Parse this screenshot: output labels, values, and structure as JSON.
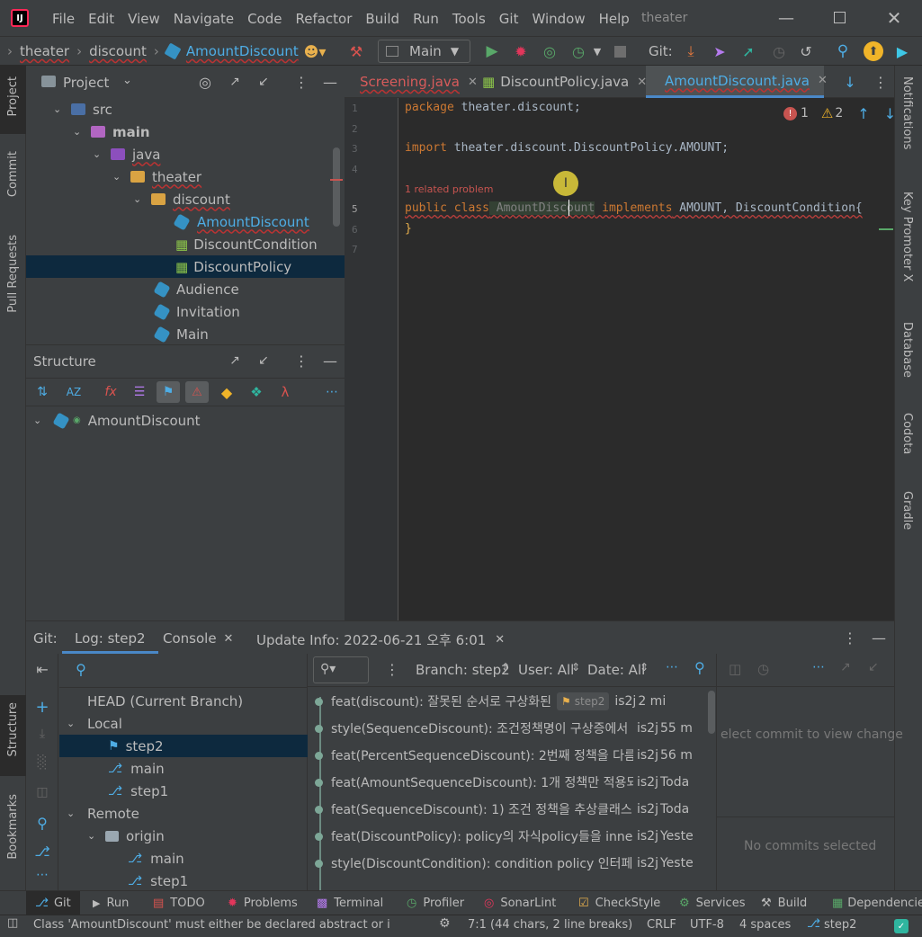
{
  "titlebar": {
    "menu": [
      "File",
      "Edit",
      "View",
      "Navigate",
      "Code",
      "Refactor",
      "Build",
      "Run",
      "Tools",
      "Git",
      "Window",
      "Help"
    ],
    "project_name": "theater"
  },
  "toolbar": {
    "breadcrumbs": [
      "theater",
      "discount",
      "AmountDiscount"
    ],
    "run_config": "Main",
    "git_label": "Git:"
  },
  "left_tools": [
    "Project",
    "Commit",
    "Pull Requests",
    "Structure",
    "Bookmarks"
  ],
  "right_tools": [
    "Notifications",
    "Key Promoter X",
    "Database",
    "Codota",
    "Gradle"
  ],
  "project": {
    "header": "Project",
    "tree": [
      {
        "label": "src",
        "indent": 0
      },
      {
        "label": "main",
        "indent": 1
      },
      {
        "label": "java",
        "indent": 2
      },
      {
        "label": "theater",
        "indent": 3
      },
      {
        "label": "discount",
        "indent": 4
      },
      {
        "label": "AmountDiscount",
        "indent": 5
      },
      {
        "label": "DiscountCondition",
        "indent": 5
      },
      {
        "label": "DiscountPolicy",
        "indent": 5
      },
      {
        "label": "Audience",
        "indent": 4
      },
      {
        "label": "Invitation",
        "indent": 4
      },
      {
        "label": "Main",
        "indent": 4
      }
    ]
  },
  "structure": {
    "header": "Structure",
    "root": "AmountDiscount"
  },
  "editor": {
    "tabs": [
      "Screening.java",
      "DiscountPolicy.java",
      "AmountDiscount.java"
    ],
    "errors": "1",
    "warnings": "2",
    "line_numbers": [
      "1",
      "2",
      "3",
      "4",
      "5",
      "6",
      "7"
    ],
    "lines": {
      "l1_kw": "package",
      "l1_rest": " theater.discount;",
      "l3_kw": "import",
      "l3_rest": " theater.discount.DiscountPolicy.AMOUNT;",
      "hint": "1 related problem",
      "l5_kw": "public class",
      "l5_name": " AmountDiscount",
      "l5_kw2": " implements",
      "l5_rest": " AMOUNT, DiscountCondition{",
      "l6": "}"
    }
  },
  "git": {
    "tabs": [
      "Git:",
      "Log: step2",
      "Console",
      "Update Info: 2022-06-21 오후 6:01"
    ],
    "branch_filter": "Branch: step2",
    "user_filter": "User: All",
    "date_filter": "Date: All",
    "branches": {
      "head": "HEAD (Current Branch)",
      "local": "Local",
      "local_items": [
        "step2",
        "main",
        "step1"
      ],
      "remote": "Remote",
      "origin": "origin",
      "remote_items": [
        "main",
        "step1"
      ]
    },
    "commits": [
      {
        "msg": "feat(discount): 잘못된 순서로 구상화된",
        "tag": "step2",
        "author": "is2j",
        "time": "2 mi"
      },
      {
        "msg": "style(SequenceDiscount): 조건정책명이 구상증에서",
        "author": "is2j",
        "time": "55 m"
      },
      {
        "msg": "feat(PercentSequenceDiscount): 2번째 정책을 다름",
        "author": "is2j",
        "time": "56 m"
      },
      {
        "msg": "feat(AmountSequenceDiscount): 1개 정책만 적용되",
        "author": "is2j",
        "time": "Toda"
      },
      {
        "msg": "feat(SequenceDiscount): 1) 조건 정책을 추상클래스",
        "author": "is2j",
        "time": "Toda"
      },
      {
        "msg": "feat(DiscountPolicy): policy의 자식policy들을 inne",
        "author": "is2j",
        "time": "Yeste"
      },
      {
        "msg": "style(DiscountCondition): condition policy 인터페",
        "author": "is2j",
        "time": "Yeste"
      }
    ],
    "select_commit": "elect commit to view change",
    "no_commits": "No commits selected"
  },
  "bottom_tabs": [
    "Git",
    "Run",
    "TODO",
    "Problems",
    "Terminal",
    "Profiler",
    "SonarLint",
    "CheckStyle",
    "Services",
    "Build",
    "Dependencies"
  ],
  "status": {
    "message": "Class 'AmountDiscount' must either be declared abstract or i",
    "position": "7:1 (44 chars, 2 line breaks)",
    "line_sep": "CRLF",
    "encoding": "UTF-8",
    "indent": "4 spaces",
    "branch": "step2"
  }
}
